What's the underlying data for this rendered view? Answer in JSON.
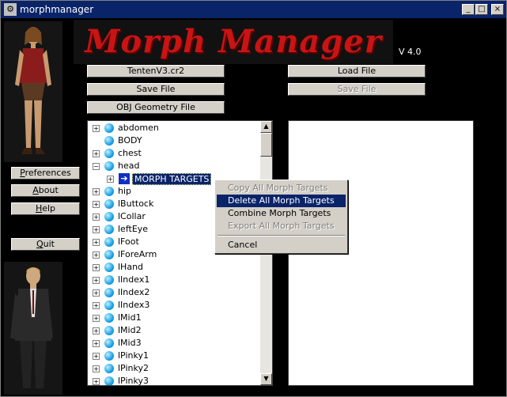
{
  "window": {
    "title": "morphmanager",
    "minimize": "_",
    "maximize": "□",
    "close": "×"
  },
  "header": {
    "logo_text": "Morph Manager",
    "version": "V 4.0"
  },
  "file_buttons": {
    "figure_file": "TentenV3.cr2",
    "load_file": "Load File",
    "save_file": "Save File",
    "save_file_right": "Save File",
    "obj_geometry": "OBJ Geometry File"
  },
  "sidebar": {
    "preferences": "Preferences",
    "about": "About",
    "help": "Help",
    "quit": "Quit"
  },
  "tree": {
    "nodes": [
      {
        "label": "abdomen",
        "expander": "+"
      },
      {
        "label": "BODY",
        "expander": ""
      },
      {
        "label": "chest",
        "expander": "+"
      },
      {
        "label": "head",
        "expander": "−"
      },
      {
        "label": "MORPH TARGETS",
        "expander": "+",
        "child": true,
        "selected": true
      },
      {
        "label": "hip",
        "expander": "+"
      },
      {
        "label": "lButtock",
        "expander": "+"
      },
      {
        "label": "lCollar",
        "expander": "+"
      },
      {
        "label": "leftEye",
        "expander": "+"
      },
      {
        "label": "lFoot",
        "expander": "+"
      },
      {
        "label": "lForeArm",
        "expander": "+"
      },
      {
        "label": "lHand",
        "expander": "+"
      },
      {
        "label": "lIndex1",
        "expander": "+"
      },
      {
        "label": "lIndex2",
        "expander": "+"
      },
      {
        "label": "lIndex3",
        "expander": "+"
      },
      {
        "label": "lMid1",
        "expander": "+"
      },
      {
        "label": "lMid2",
        "expander": "+"
      },
      {
        "label": "lMid3",
        "expander": "+"
      },
      {
        "label": "lPinky1",
        "expander": "+"
      },
      {
        "label": "lPinky2",
        "expander": "+"
      },
      {
        "label": "lPinky3",
        "expander": "+"
      }
    ],
    "scroll_up": "▲",
    "scroll_down": "▼"
  },
  "context_menu": {
    "copy_all": "Copy All Morph Targets",
    "delete_all": "Delete All Morph Targets",
    "combine": "Combine Morph Targets",
    "export_all": "Export All Morph Targets",
    "cancel": "Cancel"
  },
  "colors": {
    "titlebar": "#0a246a",
    "logo_red": "#c81414",
    "button_face": "#d4d0c8",
    "highlight": "#0a246a"
  }
}
